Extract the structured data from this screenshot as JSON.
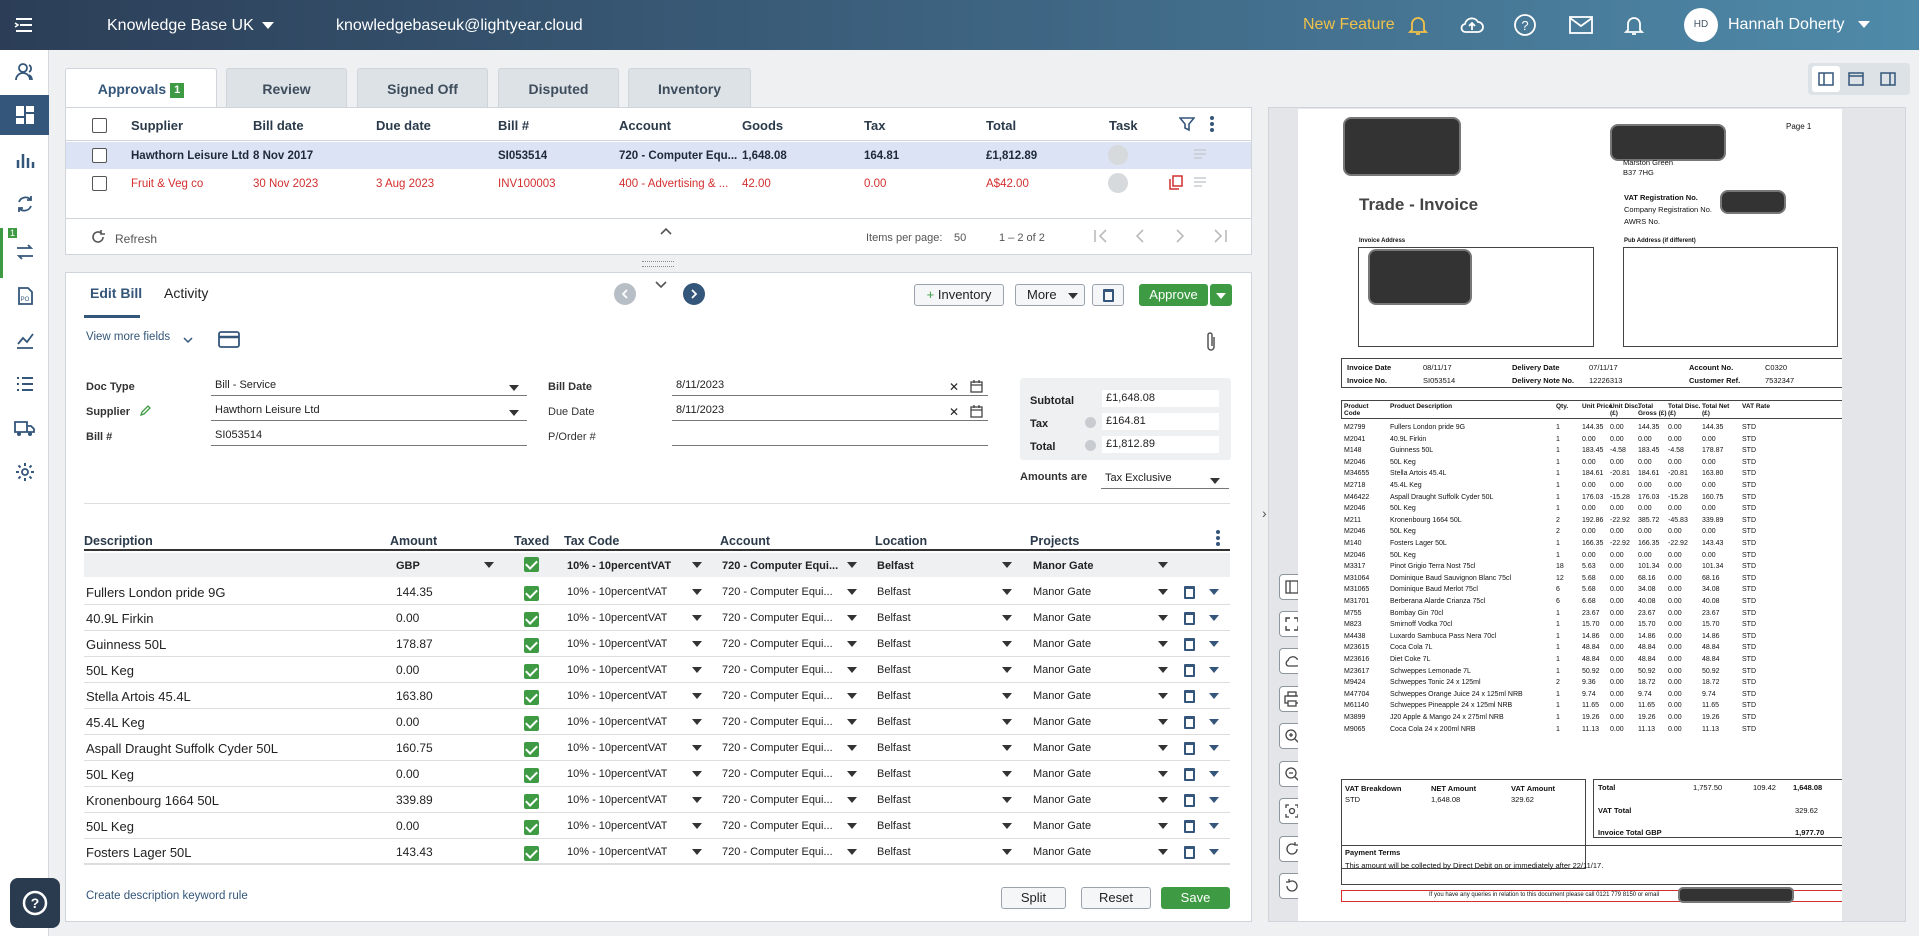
{
  "topbar": {
    "org": "Knowledge Base UK",
    "email": "knowledgebaseuk@lightyear.cloud",
    "new_feature": "New Feature",
    "user_initials": "HD",
    "user_name": "Hannah Doherty"
  },
  "sidebar": {
    "badge": "1"
  },
  "tabs": [
    {
      "label": "Approvals",
      "count": "1"
    },
    {
      "label": "Review"
    },
    {
      "label": "Signed Off"
    },
    {
      "label": "Disputed"
    },
    {
      "label": "Inventory"
    }
  ],
  "list": {
    "headers": {
      "supplier": "Supplier",
      "bill_date": "Bill date",
      "due_date": "Due date",
      "bill_no": "Bill #",
      "account": "Account",
      "goods": "Goods",
      "tax": "Tax",
      "total": "Total",
      "task": "Task"
    },
    "rows": [
      {
        "supplier": "Hawthorn Leisure Ltd",
        "bill_date": "8 Nov 2017",
        "due_date": "",
        "bill_no": "SI053514",
        "account": "720 - Computer Equ...",
        "goods": "1,648.08",
        "tax": "164.81",
        "total": "£1,812.89"
      },
      {
        "supplier": "Fruit & Veg co",
        "bill_date": "30 Nov 2023",
        "due_date": "3 Aug 2023",
        "bill_no": "INV100003",
        "account": "400 - Advertising & ...",
        "goods": "42.00",
        "tax": "0.00",
        "total": "A$42.00"
      }
    ],
    "refresh": "Refresh",
    "items_per_page_label": "Items per page:",
    "items_per_page": "50",
    "range": "1 – 2 of 2"
  },
  "edit": {
    "tab_edit": "Edit Bill",
    "tab_activity": "Activity",
    "inventory_btn": "Inventory",
    "more_btn": "More",
    "approve_btn": "Approve",
    "view_more": "View more fields",
    "doc_type_label": "Doc Type",
    "doc_type": "Bill - Service",
    "supplier_label": "Supplier",
    "supplier": "Hawthorn Leisure Ltd",
    "bill_no_label": "Bill #",
    "bill_no": "SI053514",
    "bill_date_label": "Bill Date",
    "bill_date": "8/11/2023",
    "due_date_label": "Due Date",
    "due_date": "8/11/2023",
    "porder_label": "P/Order #",
    "subtotal_label": "Subtotal",
    "subtotal": "£1,648.08",
    "tax_label": "Tax",
    "tax": "£164.81",
    "total_label": "Total",
    "total": "£1,812.89",
    "amounts_are_label": "Amounts are",
    "amounts_are": "Tax Exclusive",
    "create_rule": "Create description keyword rule",
    "split_btn": "Split",
    "reset_btn": "Reset",
    "save_btn": "Save"
  },
  "grid": {
    "headers": {
      "description": "Description",
      "amount": "Amount",
      "taxed": "Taxed",
      "tax_code": "Tax Code",
      "account": "Account",
      "location": "Location",
      "projects": "Projects"
    },
    "defaults": {
      "currency": "GBP",
      "tax_code": "10% - 10percentVAT",
      "account": "720 - Computer Equi...",
      "location": "Belfast",
      "project": "Manor Gate"
    },
    "rows": [
      {
        "description": "Fullers London pride 9G",
        "amount": "144.35",
        "tax_code": "10% - 10percentVAT",
        "account": "720 - Computer Equi...",
        "location": "Belfast",
        "project": "Manor Gate"
      },
      {
        "description": "40.9L Firkin",
        "amount": "0.00",
        "tax_code": "10% - 10percentVAT",
        "account": "720 - Computer Equi...",
        "location": "Belfast",
        "project": "Manor Gate"
      },
      {
        "description": "Guinness  50L",
        "amount": "178.87",
        "tax_code": "10% - 10percentVAT",
        "account": "720 - Computer Equi...",
        "location": "Belfast",
        "project": "Manor Gate"
      },
      {
        "description": "50L Keg",
        "amount": "0.00",
        "tax_code": "10% - 10percentVAT",
        "account": "720 - Computer Equi...",
        "location": "Belfast",
        "project": "Manor Gate"
      },
      {
        "description": "Stella Artois  45.4L",
        "amount": "163.80",
        "tax_code": "10% - 10percentVAT",
        "account": "720 - Computer Equi...",
        "location": "Belfast",
        "project": "Manor Gate"
      },
      {
        "description": "45.4L Keg",
        "amount": "0.00",
        "tax_code": "10% - 10percentVAT",
        "account": "720 - Computer Equi...",
        "location": "Belfast",
        "project": "Manor Gate"
      },
      {
        "description": "Aspall Draught Suffolk Cyder 50L",
        "amount": "160.75",
        "tax_code": "10% - 10percentVAT",
        "account": "720 - Computer Equi...",
        "location": "Belfast",
        "project": "Manor Gate"
      },
      {
        "description": "50L Keg",
        "amount": "0.00",
        "tax_code": "10% - 10percentVAT",
        "account": "720 - Computer Equi...",
        "location": "Belfast",
        "project": "Manor Gate"
      },
      {
        "description": "Kronenbourg 1664  50L",
        "amount": "339.89",
        "tax_code": "10% - 10percentVAT",
        "account": "720 - Computer Equi...",
        "location": "Belfast",
        "project": "Manor Gate"
      },
      {
        "description": "50L Keg",
        "amount": "0.00",
        "tax_code": "10% - 10percentVAT",
        "account": "720 - Computer Equi...",
        "location": "Belfast",
        "project": "Manor Gate"
      },
      {
        "description": "Fosters Lager  50L",
        "amount": "143.43",
        "tax_code": "10% - 10percentVAT",
        "account": "720 - Computer Equi...",
        "location": "Belfast",
        "project": "Manor Gate"
      }
    ]
  },
  "invoice": {
    "page": "Page  1",
    "addr1": "Marston Green",
    "addr2": "B37 7HG",
    "title": "Trade - Invoice",
    "vat_reg": "VAT Registration No.",
    "company_reg": "Company Registration No.",
    "awrs": "AWRS No.",
    "invoice_address": "Invoice Address",
    "pub_address": "Pub Address (if different)",
    "invoice_date_label": "Invoice Date",
    "invoice_date": "08/11/17",
    "invoice_no_label": "Invoice No.",
    "invoice_no": "SI053514",
    "delivery_date_label": "Delivery Date",
    "delivery_date": "07/11/17",
    "delivery_note_label": "Delivery Note No.",
    "delivery_note": "12226313",
    "account_no_label": "Account No.",
    "account_no": "C0320",
    "customer_ref_label": "Customer Ref.",
    "customer_ref": "7532347",
    "cols": [
      "Product Code",
      "Product Description",
      "Qty.",
      "Unit Price",
      "Unit Disc. (£)",
      "Total Gross (£)",
      "Total Disc. (£)",
      "Total Net (£)",
      "VAT Rate"
    ],
    "lines": [
      [
        "M2799",
        "Fullers London pride 9G",
        "1",
        "144.35",
        "0.00",
        "144.35",
        "0.00",
        "144.35",
        "STD"
      ],
      [
        "M2041",
        "40.9L Firkin",
        "1",
        "0.00",
        "0.00",
        "0.00",
        "0.00",
        "0.00",
        "STD"
      ],
      [
        "M148",
        "Guinness  50L",
        "1",
        "183.45",
        "-4.58",
        "183.45",
        "-4.58",
        "178.87",
        "STD"
      ],
      [
        "M2046",
        "50L Keg",
        "1",
        "0.00",
        "0.00",
        "0.00",
        "0.00",
        "0.00",
        "STD"
      ],
      [
        "M34655",
        "Stella Artois  45.4L",
        "1",
        "184.61",
        "-20.81",
        "184.61",
        "-20.81",
        "163.80",
        "STD"
      ],
      [
        "M2718",
        "45.4L Keg",
        "1",
        "0.00",
        "0.00",
        "0.00",
        "0.00",
        "0.00",
        "STD"
      ],
      [
        "M46422",
        "Aspall Draught Suffolk Cyder 50L",
        "1",
        "176.03",
        "-15.28",
        "176.03",
        "-15.28",
        "160.75",
        "STD"
      ],
      [
        "M2046",
        "50L Keg",
        "1",
        "0.00",
        "0.00",
        "0.00",
        "0.00",
        "0.00",
        "STD"
      ],
      [
        "M211",
        "Kronenbourg 1664  50L",
        "2",
        "192.86",
        "-22.92",
        "385.72",
        "-45.83",
        "339.89",
        "STD"
      ],
      [
        "M2046",
        "50L Keg",
        "2",
        "0.00",
        "0.00",
        "0.00",
        "0.00",
        "0.00",
        "STD"
      ],
      [
        "M140",
        "Fosters Lager  50L",
        "1",
        "166.35",
        "-22.92",
        "166.35",
        "-22.92",
        "143.43",
        "STD"
      ],
      [
        "M2046",
        "50L Keg",
        "1",
        "0.00",
        "0.00",
        "0.00",
        "0.00",
        "0.00",
        "STD"
      ],
      [
        "M3317",
        "Pinot Grigio Terra Nost  75cl",
        "18",
        "5.63",
        "0.00",
        "101.34",
        "0.00",
        "101.34",
        "STD"
      ],
      [
        "M31064",
        "Dominique Baud Sauvignon Blanc  75cl",
        "12",
        "5.68",
        "0.00",
        "68.16",
        "0.00",
        "68.16",
        "STD"
      ],
      [
        "M31065",
        "Dominique Baud Merlot  75cl",
        "6",
        "5.68",
        "0.00",
        "34.08",
        "0.00",
        "34.08",
        "STD"
      ],
      [
        "M31701",
        "Berberana Alarde Crianza  75cl",
        "6",
        "6.68",
        "0.00",
        "40.08",
        "0.00",
        "40.08",
        "STD"
      ],
      [
        "M755",
        "Bombay Gin  70cl",
        "1",
        "23.67",
        "0.00",
        "23.67",
        "0.00",
        "23.67",
        "STD"
      ],
      [
        "M823",
        "Smirnoff Vodka  70cl",
        "1",
        "15.70",
        "0.00",
        "15.70",
        "0.00",
        "15.70",
        "STD"
      ],
      [
        "M4438",
        "Luxardo Sambuca Pass Nera  70cl",
        "1",
        "14.86",
        "0.00",
        "14.86",
        "0.00",
        "14.86",
        "STD"
      ],
      [
        "M23615",
        "Coca Cola  7L",
        "1",
        "48.84",
        "0.00",
        "48.84",
        "0.00",
        "48.84",
        "STD"
      ],
      [
        "M23616",
        "Diet Coke  7L",
        "1",
        "48.84",
        "0.00",
        "48.84",
        "0.00",
        "48.84",
        "STD"
      ],
      [
        "M23617",
        "Schweppes Lemonade  7L",
        "1",
        "50.92",
        "0.00",
        "50.92",
        "0.00",
        "50.92",
        "STD"
      ],
      [
        "M9424",
        "Schweppes Tonic 24 x 125ml",
        "2",
        "9.36",
        "0.00",
        "18.72",
        "0.00",
        "18.72",
        "STD"
      ],
      [
        "M47704",
        "Schweppes Orange Juice  24 x 125ml NRB",
        "1",
        "9.74",
        "0.00",
        "9.74",
        "0.00",
        "9.74",
        "STD"
      ],
      [
        "M61140",
        "Schweppes Pineapple  24 x 125ml NRB",
        "1",
        "11.65",
        "0.00",
        "11.65",
        "0.00",
        "11.65",
        "STD"
      ],
      [
        "M3899",
        "J20 Apple & Mango  24 x 275ml NRB",
        "1",
        "19.26",
        "0.00",
        "19.26",
        "0.00",
        "19.26",
        "STD"
      ],
      [
        "M9065",
        "Coca Cola  24 x 200ml NRB",
        "1",
        "11.13",
        "0.00",
        "11.13",
        "0.00",
        "11.13",
        "STD"
      ]
    ],
    "vat_breakdown": "VAT Breakdown",
    "net_amount_label": "NET Amount",
    "vat_amount_label": "VAT Amount",
    "vat_code": "STD",
    "net_amount": "1,648.08",
    "vat_amount": "329.62",
    "total_label": "Total",
    "total_a": "1,757.50",
    "total_b": "109.42",
    "total_c": "1,648.08",
    "vat_total_label": "VAT Total",
    "vat_total": "329.62",
    "invoice_total_label": "Invoice Total GBP",
    "invoice_total": "1,977.70",
    "payment_terms_label": "Payment Terms",
    "payment_terms": "This amount will be collected by Direct Debit  on or immediately after 22/11/17.",
    "footer": "If you have any queries in relation to this document please call 0121 779 8150 or email"
  },
  "colors": {
    "accent": "#34567a",
    "green": "#3e9b43",
    "red": "#d32f2f",
    "selected_row": "#dbe3f4"
  }
}
